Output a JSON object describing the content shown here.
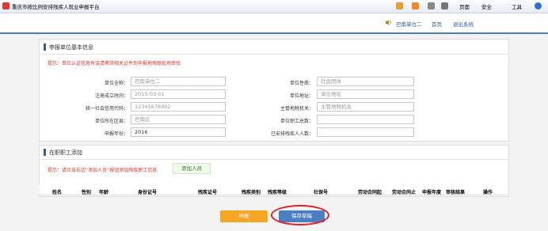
{
  "browser": {
    "tab_title": "重庆市按比例安排残疾人就业申报平台",
    "toolbar": [
      "页面",
      "安全",
      "工具"
    ]
  },
  "topnav": {
    "user": "巴南单位二",
    "home": "首页",
    "logout": "退出系统"
  },
  "section1": {
    "title": "申报单位基本信息",
    "hint": "提示：单位认证信息有误请携带相关证件到申报地残联现场审验",
    "left": [
      {
        "label": "单位全称：",
        "value": "巴南单位二",
        "dark": false
      },
      {
        "label": "注册成立时间：",
        "value": "2015-03-01",
        "dark": false
      },
      {
        "label": "统一社会信用代码：",
        "value": "12345678902",
        "dark": false
      },
      {
        "label": "单位所在区县：",
        "value": "巴南区",
        "dark": false
      },
      {
        "label": "申报年份：",
        "value": "2016",
        "dark": true
      }
    ],
    "right": [
      {
        "label": "单位性质：",
        "value": "社会团体",
        "dark": false
      },
      {
        "label": "单位地址：",
        "value": "单位地址",
        "dark": false
      },
      {
        "label": "主管地税机关：",
        "value": "主管地税机关",
        "dark": false
      },
      {
        "label": "单位职工总数：",
        "value": "",
        "dark": false
      },
      {
        "label": "已安排残疾人人数：",
        "value": "",
        "dark": false
      }
    ]
  },
  "section2": {
    "title": "在职职工添加",
    "hint": "提示：请点击右边“添加人员”按钮添加残疾职工信息",
    "add_button": "添加人员",
    "columns": [
      "姓名",
      "性别",
      "年龄",
      "身份证号",
      "残疾证号",
      "残疾类别",
      "残疾等级",
      "社保号",
      "劳动合同起",
      "劳动合同止",
      "申报年度",
      "审核结果",
      "操作"
    ]
  },
  "actions": {
    "submit": "申报",
    "save_draft": "保存草稿"
  },
  "colors": {
    "accent_blue": "#2d5fa8",
    "submit_orange": "#f5a623",
    "save_blue": "#4a7fc1",
    "hint_red": "#d9342b",
    "highlight_circle": "#e0202a"
  }
}
